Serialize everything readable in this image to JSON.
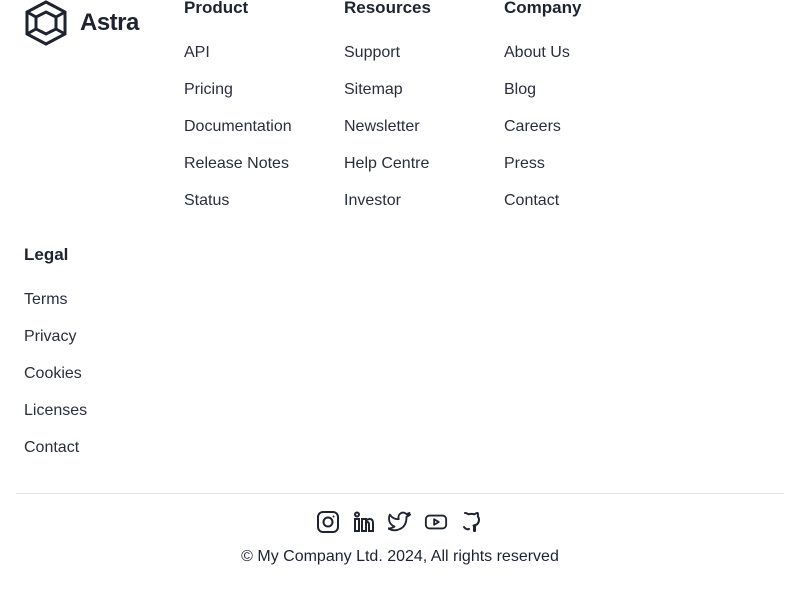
{
  "brand": {
    "name": "Astra",
    "logo_icon": "astra-logo-icon"
  },
  "columns": [
    {
      "title": "Product",
      "items": [
        "API",
        "Pricing",
        "Documentation",
        "Release Notes",
        "Status"
      ]
    },
    {
      "title": "Resources",
      "items": [
        "Support",
        "Sitemap",
        "Newsletter",
        "Help Centre",
        "Investor"
      ]
    },
    {
      "title": "Company",
      "items": [
        "About Us",
        "Blog",
        "Careers",
        "Press",
        "Contact"
      ]
    }
  ],
  "legal": {
    "title": "Legal",
    "items": [
      "Terms",
      "Privacy",
      "Cookies",
      "Licenses",
      "Contact"
    ]
  },
  "socials": [
    {
      "name": "instagram-icon"
    },
    {
      "name": "linkedin-icon"
    },
    {
      "name": "twitter-icon"
    },
    {
      "name": "youtube-icon"
    },
    {
      "name": "github-icon"
    }
  ],
  "footer": {
    "copyright": "© My Company Ltd. 2024, All rights reserved"
  },
  "colors": {
    "text": "#1f2330",
    "divider": "#e6e7eb"
  }
}
